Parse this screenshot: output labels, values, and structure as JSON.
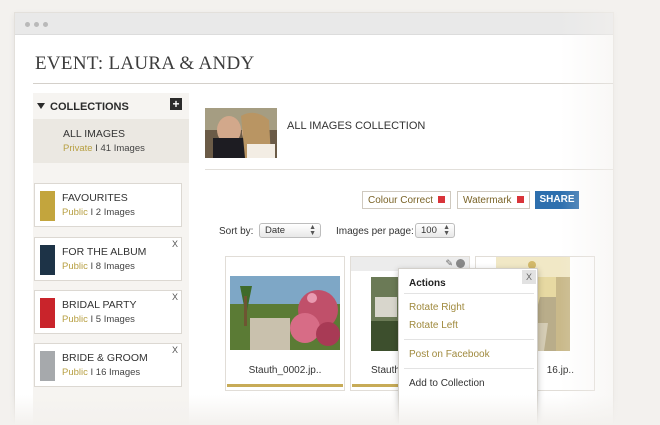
{
  "page_title": "EVENT: LAURA & ANDY",
  "sidebar": {
    "heading": "COLLECTIONS",
    "add_icon": "plus-icon",
    "all_images": {
      "name": "ALL IMAGES",
      "visibility": "Private",
      "sep": " I ",
      "count": "41 Images"
    },
    "collections": [
      {
        "name": "FAVOURITES",
        "visibility": "Public",
        "count": "2 Images",
        "color": "#c3a53d",
        "close": ""
      },
      {
        "name": "FOR THE ALBUM",
        "visibility": "Public",
        "count": "8 Images",
        "color": "#1d3347",
        "close": "X"
      },
      {
        "name": "BRIDAL PARTY",
        "visibility": "Public",
        "count": "5 Images",
        "color": "#c9242b",
        "close": "X"
      },
      {
        "name": "BRIDE & GROOM",
        "visibility": "Public",
        "count": "16 Images",
        "color": "#a6a9ac",
        "close": "X"
      }
    ],
    "sep": " I "
  },
  "main": {
    "collection_title": "ALL IMAGES COLLECTION",
    "buttons": {
      "colour_correct": "Colour Correct",
      "watermark": "Watermark",
      "share": "SHARE"
    },
    "sort_by": {
      "label": "Sort by:",
      "value": "Date"
    },
    "per_page": {
      "label": "Images per page:",
      "value": "100"
    },
    "tiles": [
      {
        "caption": "Stauth_0002.jp.."
      },
      {
        "caption": "Stauth"
      },
      {
        "caption": "16.jp.."
      }
    ],
    "menu": {
      "title": "Actions",
      "close": "X",
      "items": [
        "Rotate Right",
        "Rotate Left",
        "Post on Facebook",
        "Add to Collection"
      ]
    }
  },
  "colors": {
    "accent_gold": "#b8a043",
    "share_blue": "#2d6fae",
    "red_marker": "#d9343a"
  }
}
